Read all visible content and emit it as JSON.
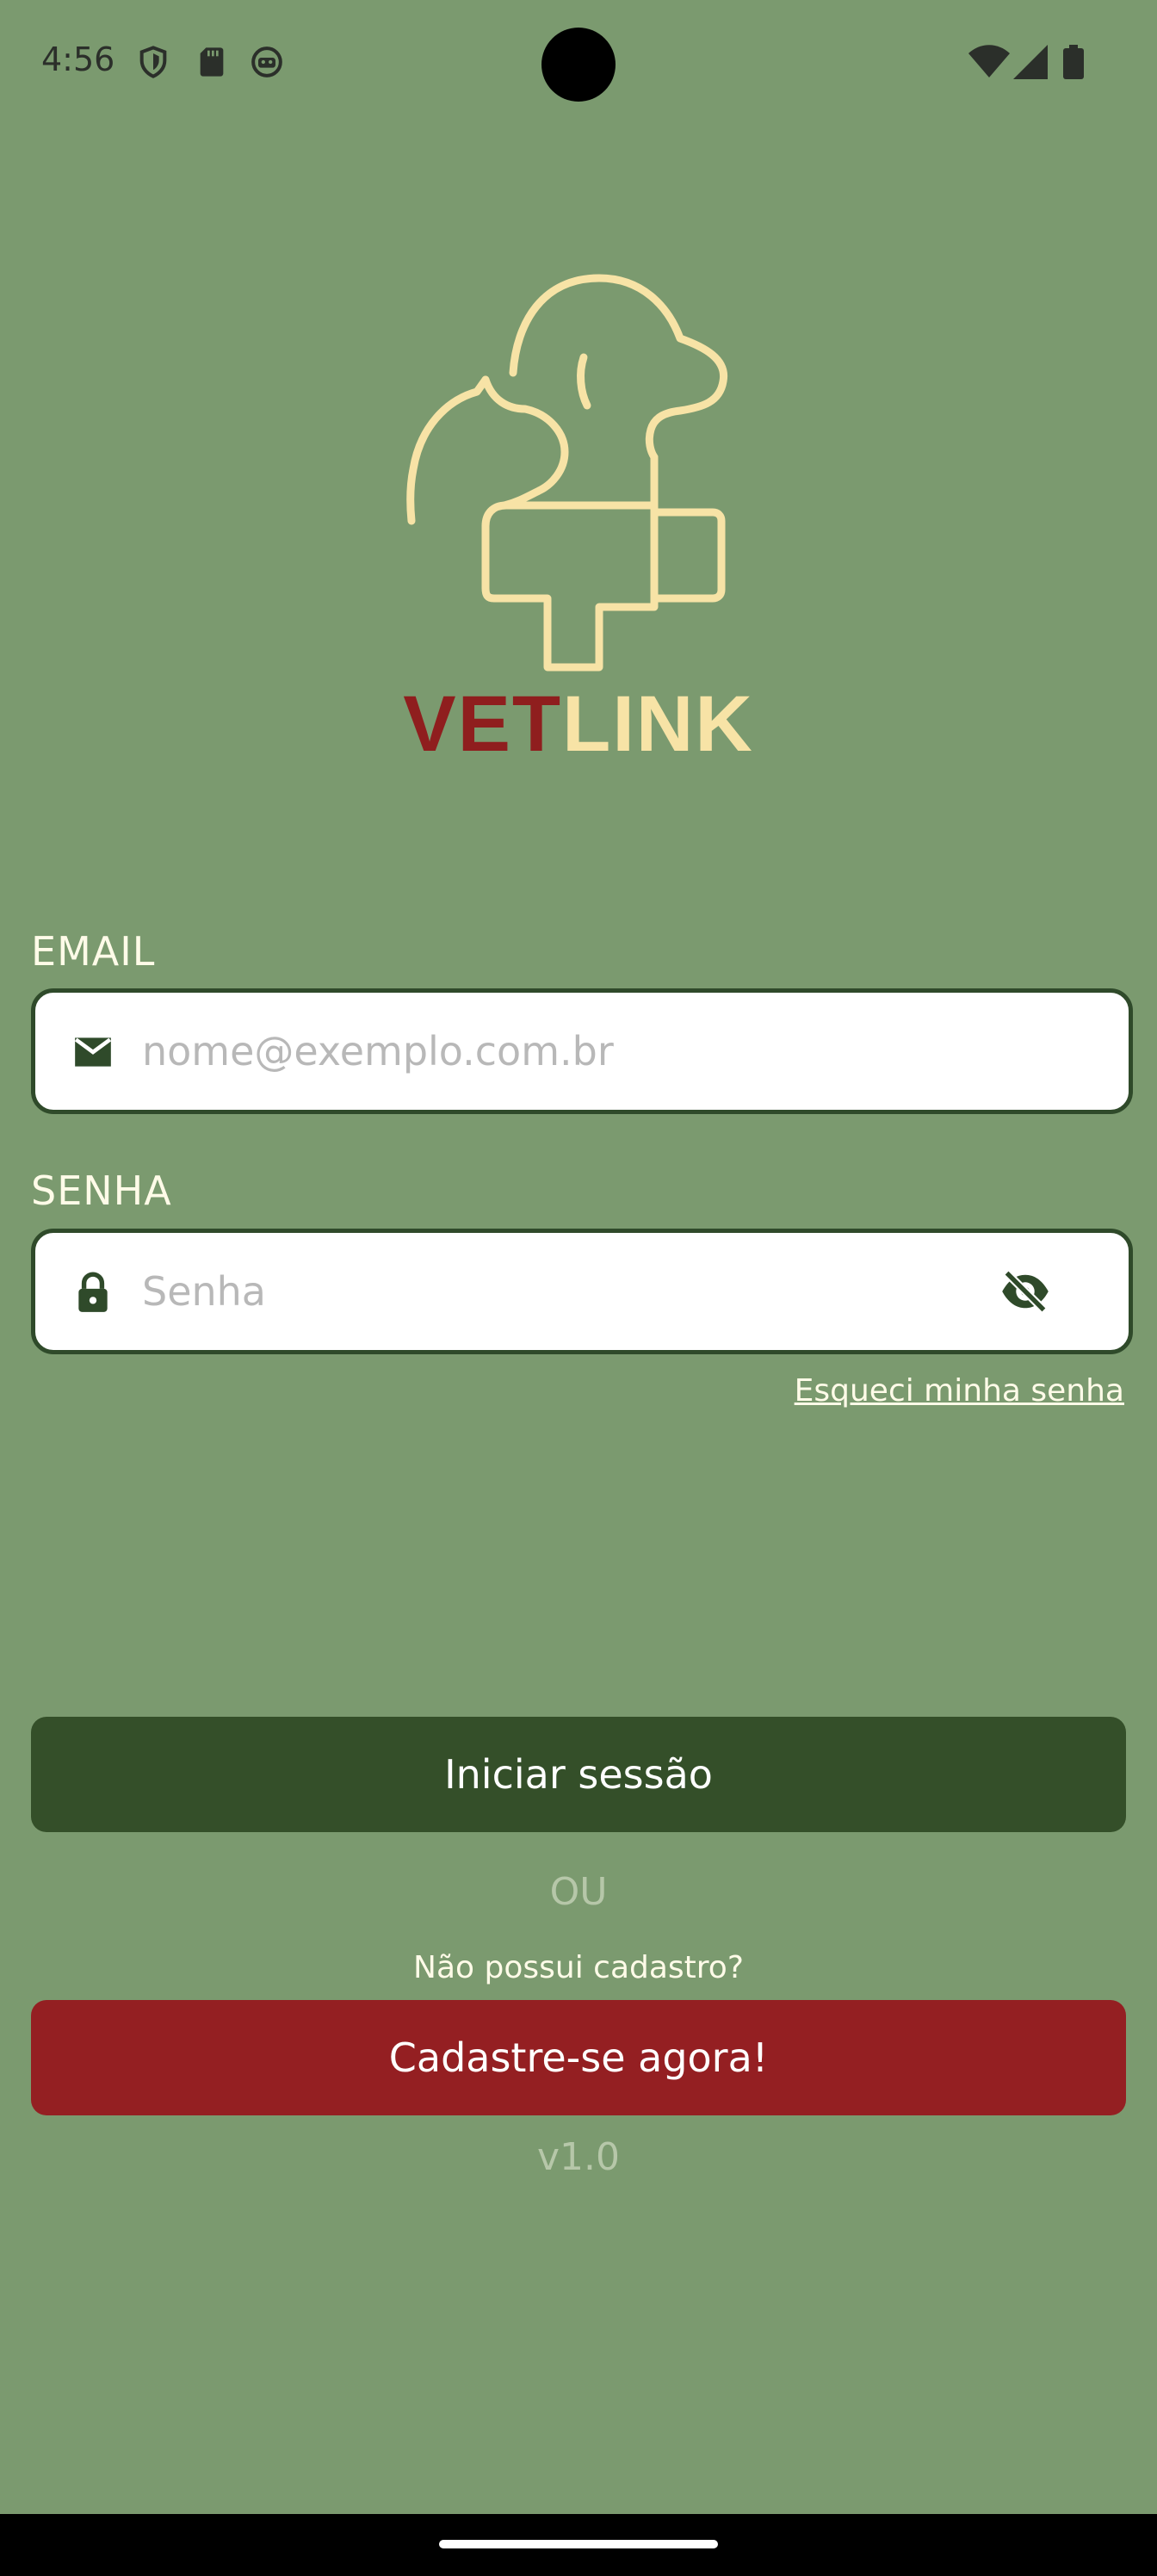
{
  "status_bar": {
    "time": "4:56",
    "icons": [
      "shield-icon",
      "sd-card-icon",
      "robot-icon"
    ],
    "right_icons": [
      "wifi-icon",
      "signal-icon",
      "battery-icon"
    ]
  },
  "brand": {
    "part1": "VET",
    "part2": "LINK",
    "colors": {
      "vet": "#8f1e1e",
      "link": "#f7e3a6"
    }
  },
  "email": {
    "label": "EMAIL",
    "placeholder": "nome@exemplo.com.br",
    "value": "",
    "icon": "mail-icon"
  },
  "password": {
    "label": "SENHA",
    "placeholder": "Senha",
    "value": "",
    "icon": "lock-icon",
    "toggle_icon": "eye-off-icon"
  },
  "forgot_password": "Esqueci minha senha",
  "login_button": "Iniciar sessão",
  "or_text": "OU",
  "no_account_text": "Não possui cadastro?",
  "signup_button": "Cadastre-se agora!",
  "version": "v1.0",
  "colors": {
    "background": "#7b9a6f",
    "primary": "#344f29",
    "accent": "#941f22",
    "logo": "#f7e3a6"
  }
}
